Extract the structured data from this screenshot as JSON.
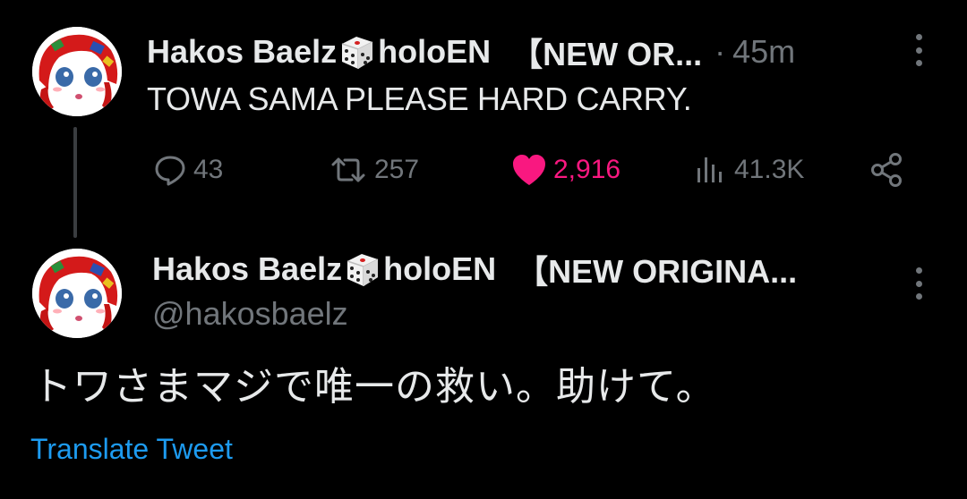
{
  "tweet1": {
    "display_name": "Hakos Baelz",
    "name_suffix": "holoEN",
    "name_tag": "【NEW OR...",
    "separator": "·",
    "time": "45m",
    "text": "TOWA SAMA PLEASE HARD CARRY.",
    "stats": {
      "replies": "43",
      "retweets": "257",
      "likes": "2,916",
      "views": "41.3K"
    }
  },
  "tweet2": {
    "display_name": "Hakos Baelz",
    "name_suffix": "holoEN",
    "name_tag": "【NEW ORIGINA...",
    "handle": "@hakosbaelz",
    "text": "トワさまマジで唯一の救い。助けて。",
    "translate_label": "Translate Tweet"
  },
  "colors": {
    "background": "#000000",
    "text": "#e7e9ea",
    "muted": "#71767b",
    "like": "#f91880",
    "link": "#1d9bf0"
  },
  "icons": [
    "dice-icon",
    "more-icon",
    "reply-icon",
    "retweet-icon",
    "heart-icon",
    "views-icon",
    "share-icon"
  ]
}
